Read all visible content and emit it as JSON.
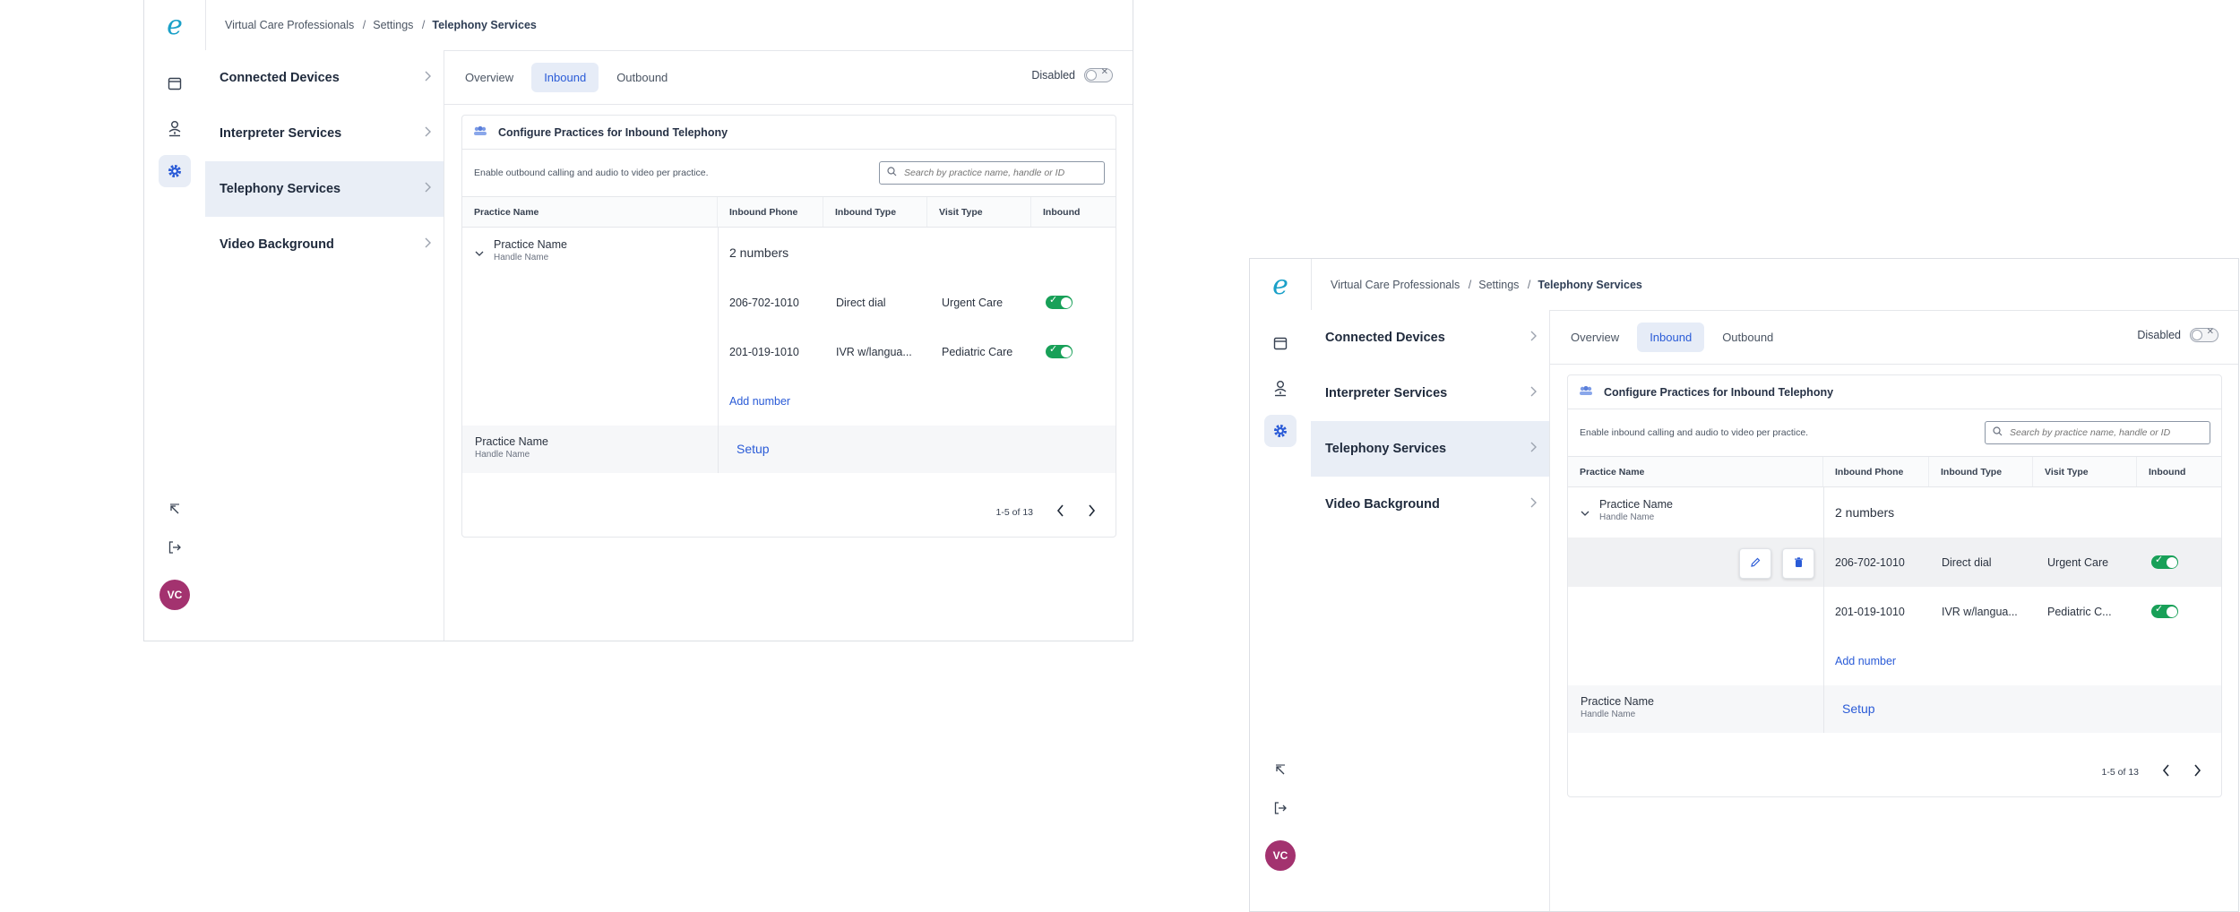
{
  "app": {
    "breadcrumb": [
      "Virtual Care Professionals",
      "Settings",
      "Telephony Services"
    ],
    "nav": [
      "Connected Devices",
      "Interpreter Services",
      "Telephony Services",
      "Video Background"
    ],
    "tabs": [
      "Overview",
      "Inbound",
      "Outbound"
    ],
    "active_tab": "Inbound",
    "status_label": "Disabled",
    "card_title": "Configure Practices for Inbound Telephony",
    "search_placeholder": "Search by practice name, handle or ID",
    "columns": [
      "Practice Name",
      "Inbound Phone",
      "Inbound Type",
      "Visit Type",
      "Inbound"
    ],
    "group": {
      "practice": "Practice Name",
      "handle": "Handle Name",
      "count": "2 numbers",
      "numbers": [
        {
          "phone": "206-702-1010",
          "type": "Direct dial",
          "visit": "Urgent Care",
          "enabled": true
        },
        {
          "phone": "201-019-1010",
          "type": "IVR w/langua...",
          "visit": "Pediatric Care",
          "enabled": true
        }
      ],
      "add_label": "Add number"
    },
    "setup_row": {
      "practice": "Practice Name",
      "handle": "Handle Name",
      "action": "Setup"
    },
    "pagination": "1-5 of 13",
    "avatar": "VC",
    "icons": [
      "calendar-icon",
      "user-network-icon",
      "gear-icon",
      "collapse-icon",
      "logout-icon",
      "search-icon",
      "chevron-right-icon",
      "chevron-down-icon",
      "pencil-icon",
      "trash-icon",
      "check-icon",
      "x-icon"
    ],
    "colors": {
      "accent": "#2a5bd7",
      "toggle_on": "#18a058",
      "avatar": "#a3326f",
      "logo": "#1aa0c8"
    }
  },
  "screen1": {
    "description_line": "Enable outbound calling and audio to video per practice.",
    "number_rows": [
      "Pediatric Care"
    ]
  },
  "screen2": {
    "description_line": "Enable inbound calling and audio to video per practice.",
    "number_rows": [
      "Pediatric C..."
    ]
  }
}
